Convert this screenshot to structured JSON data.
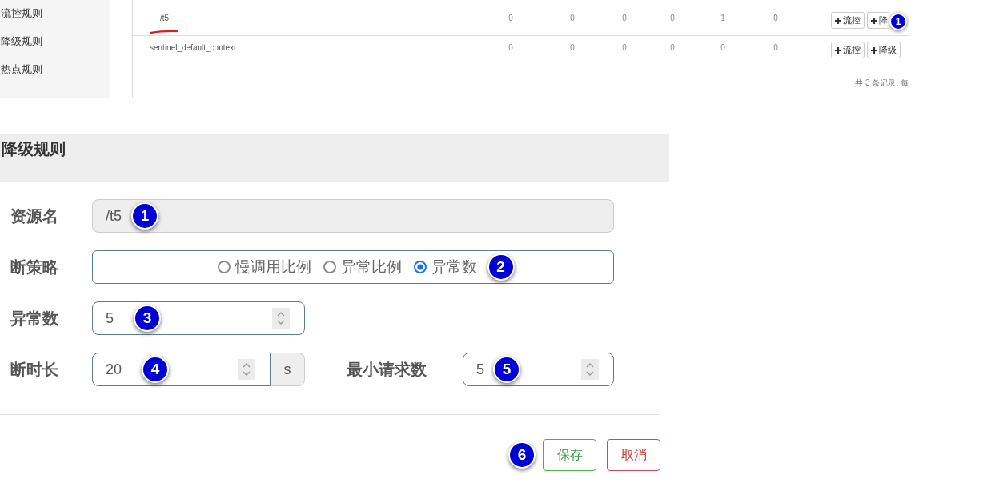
{
  "sidebar": {
    "items": [
      {
        "label": "流控规则"
      },
      {
        "label": "降级规则"
      },
      {
        "label": "热点规则"
      }
    ]
  },
  "resource_table": {
    "rows": [
      {
        "kind": "child",
        "name": "/t5",
        "underlined": true,
        "values": [
          "0",
          "0",
          "0",
          "0",
          "1",
          "0"
        ],
        "actions": [
          {
            "label": "流控"
          },
          {
            "label": "降",
            "badge": "1"
          }
        ]
      },
      {
        "kind": "root",
        "name": "sentinel_default_context",
        "underlined": false,
        "values": [
          "0",
          "0",
          "0",
          "0",
          "0",
          "0"
        ],
        "actions": [
          {
            "label": "流控"
          },
          {
            "label": "降级"
          }
        ]
      }
    ],
    "footer": "共 3 条记录, 每"
  },
  "dialog": {
    "title": "降级规则",
    "rows": [
      {
        "fields": [
          {
            "kind": "text",
            "label": "资源名",
            "value": "/t5",
            "disabled": true,
            "badge": "1"
          }
        ]
      },
      {
        "fields": [
          {
            "kind": "radio",
            "label": "断策略",
            "disabled": false,
            "options": [
              {
                "label": "慢调用比例",
                "selected": false
              },
              {
                "label": "异常比例",
                "selected": false
              },
              {
                "label": "异常数",
                "selected": true
              }
            ],
            "badge": "2"
          }
        ]
      },
      {
        "fields": [
          {
            "kind": "number",
            "label": "异常数",
            "value": "5",
            "disabled": false,
            "badge": "3"
          }
        ]
      },
      {
        "fields": [
          {
            "kind": "number",
            "label": "断时长",
            "value": "20",
            "unit": "s",
            "disabled": false,
            "badge": "4"
          },
          {
            "kind": "number",
            "label": "最小请求数",
            "value": "5",
            "disabled": false,
            "badge": "5"
          }
        ]
      }
    ],
    "buttons": [
      {
        "kind": "save",
        "label": "保存",
        "badge": "6"
      },
      {
        "kind": "cancel",
        "label": "取消"
      }
    ]
  }
}
